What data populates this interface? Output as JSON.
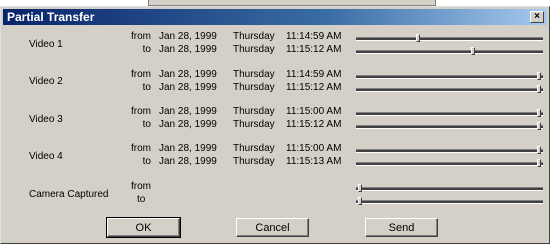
{
  "window": {
    "title": "Partial Transfer",
    "close_label": "×"
  },
  "videos": [
    {
      "label": "Video 1",
      "from_label": "from",
      "to_label": "to",
      "from_date": "Jan 28, 1999",
      "from_day": "Thursday",
      "from_time": "11:14:59 AM",
      "to_date": "Jan 28, 1999",
      "to_day": "Thursday",
      "to_time": "11:15:12 AM",
      "from_pos": 0.33,
      "to_pos": 0.63
    },
    {
      "label": "Video 2",
      "from_label": "from",
      "to_label": "to",
      "from_date": "Jan 28, 1999",
      "from_day": "Thursday",
      "from_time": "11:14:59 AM",
      "to_date": "Jan 28, 1999",
      "to_day": "Thursday",
      "to_time": "11:15:12 AM",
      "from_pos": 0.99,
      "to_pos": 0.99
    },
    {
      "label": "Video 3",
      "from_label": "from",
      "to_label": "to",
      "from_date": "Jan 28, 1999",
      "from_day": "Thursday",
      "from_time": "11:15:00 AM",
      "to_date": "Jan 28, 1999",
      "to_day": "Thursday",
      "to_time": "11:15:12 AM",
      "from_pos": 0.99,
      "to_pos": 0.99
    },
    {
      "label": "Video 4",
      "from_label": "from",
      "to_label": "to",
      "from_date": "Jan 28, 1999",
      "from_day": "Thursday",
      "from_time": "11:15:00 AM",
      "to_date": "Jan 28, 1999",
      "to_day": "Thursday",
      "to_time": "11:15:13 AM",
      "from_pos": 0.99,
      "to_pos": 0.99
    }
  ],
  "camera": {
    "label": "Camera Captured",
    "from_label": "from",
    "to_label": "to",
    "from_pos": 0.01,
    "to_pos": 0.01
  },
  "buttons": {
    "ok": "OK",
    "cancel": "Cancel",
    "send": "Send"
  }
}
